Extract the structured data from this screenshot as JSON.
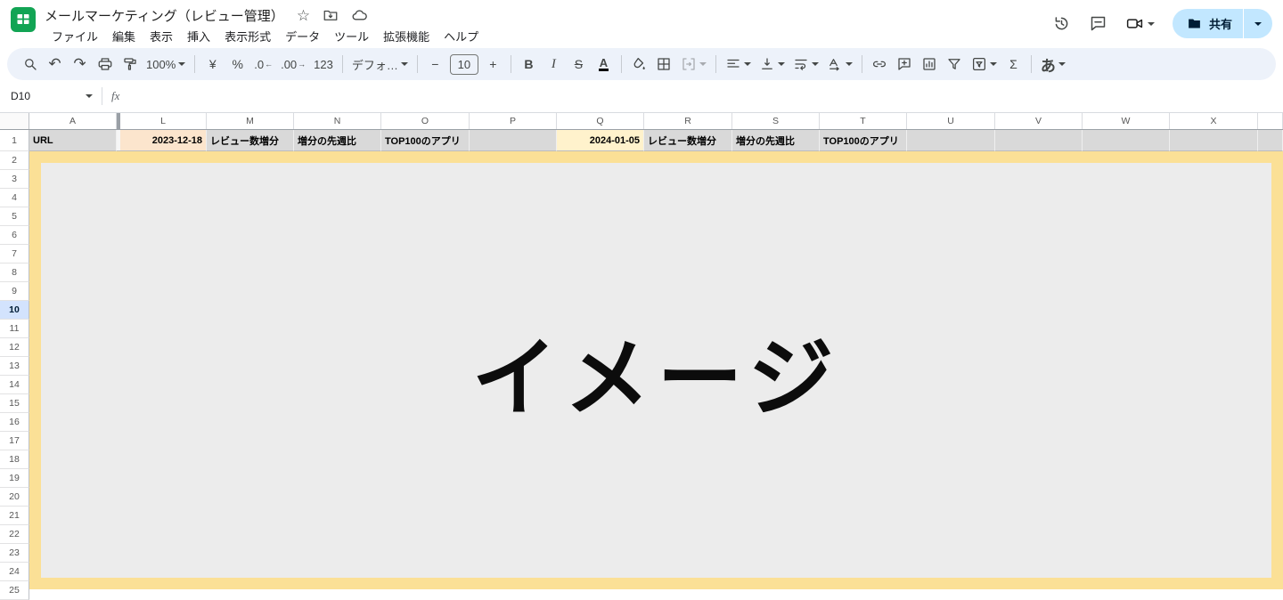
{
  "topbar": {
    "title": "メールマーケティング（レビュー管理）",
    "star": "☆",
    "menus": {
      "file": "ファイル",
      "edit": "編集",
      "view": "表示",
      "insert": "挿入",
      "format": "表示形式",
      "data": "データ",
      "tools": "ツール",
      "extensions": "拡張機能",
      "help": "ヘルプ"
    },
    "share_label": "共有"
  },
  "toolbar": {
    "zoom": "100%",
    "currency": "¥",
    "percent": "%",
    "dec_decrease": ".0",
    "dec_decrease_arrow": "←",
    "dec_increase": ".00",
    "dec_increase_arrow": "→",
    "more_formats": "123",
    "font_name": "デフォ…",
    "minus": "−",
    "font_size": "10",
    "plus": "+",
    "bold": "B",
    "italic": "I",
    "strikethrough": "S",
    "text_color": "A",
    "functions": "Σ",
    "input_tools": "あ"
  },
  "formula_bar": {
    "name_box": "D10",
    "fx": "fx"
  },
  "sheet": {
    "selected_cell": "D10",
    "col_letters": [
      "A",
      "L",
      "M",
      "N",
      "O",
      "P",
      "Q",
      "R",
      "S",
      "T",
      "U",
      "V",
      "W",
      "X"
    ],
    "row_numbers": [
      "1",
      "2",
      "3",
      "4",
      "5",
      "6",
      "7",
      "8",
      "9",
      "10",
      "11",
      "12",
      "13",
      "14",
      "15",
      "16",
      "17",
      "18",
      "19",
      "20",
      "21",
      "22",
      "23",
      "24",
      "25"
    ],
    "row1": {
      "a": "URL",
      "l": "2023-12-18",
      "m": "レビュー数増分",
      "n": "増分の先週比",
      "o": "TOP100のアプリ",
      "q": "2024-01-05",
      "r": "レビュー数増分",
      "s": "増分の先週比",
      "t": "TOP100のアプリ"
    },
    "image_text": "イメージ"
  },
  "colors": {
    "share_bg": "#c2e7ff",
    "toolbar_bg": "#edf2fa",
    "selected_row_bg": "#d3e3fd",
    "header_cell_gray": "#d9d9d9",
    "date1_bg": "#fce5cd",
    "date2_bg": "#fff2cc",
    "image_border": "#fbe096",
    "image_bg": "#ececec",
    "sheets_green": "#12a454"
  }
}
